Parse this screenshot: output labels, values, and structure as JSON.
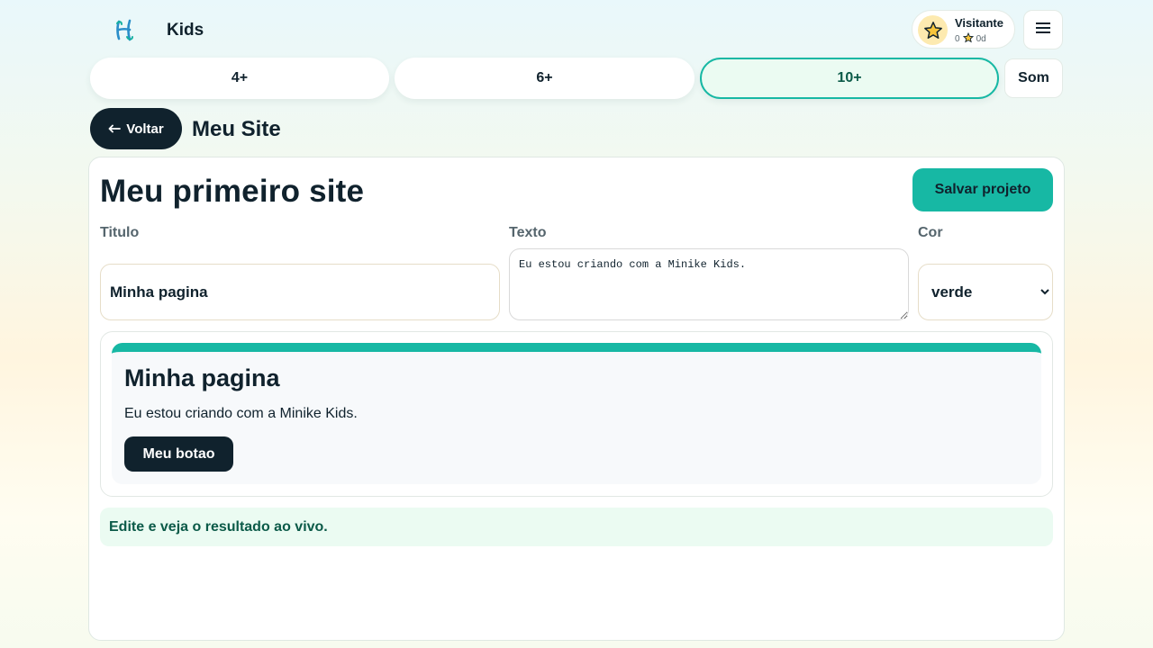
{
  "header": {
    "brand": "Kids",
    "logo_icon": "script-h-logo-icon",
    "user": {
      "name": "Visitante",
      "stars": "0",
      "days": "0d",
      "avatar_icon": "star-icon"
    },
    "menu_icon": "hamburger-icon"
  },
  "age_tabs": [
    {
      "label": "4+",
      "active": false
    },
    {
      "label": "6+",
      "active": false
    },
    {
      "label": "10+",
      "active": true
    }
  ],
  "sound_label": "Som",
  "nav": {
    "back_label": "Voltar",
    "page_title": "Meu Site"
  },
  "editor": {
    "title": "Meu primeiro site",
    "save_label": "Salvar projeto",
    "fields": {
      "title_label": "Titulo",
      "title_value": "Minha pagina",
      "text_label": "Texto",
      "text_value": "Eu estou criando com a Minike Kids.",
      "color_label": "Cor",
      "color_value": "verde"
    },
    "preview": {
      "title": "Minha pagina",
      "text": "Eu estou criando com a Minike Kids.",
      "button_label": "Meu botao",
      "accent_color": "#17b8a4"
    },
    "hint": "Edite e veja o resultado ao vivo."
  },
  "colors": {
    "accent": "#17b8a4",
    "dark": "#10222d",
    "hint_bg": "#ebfbf2",
    "hint_text": "#0b5a48"
  }
}
